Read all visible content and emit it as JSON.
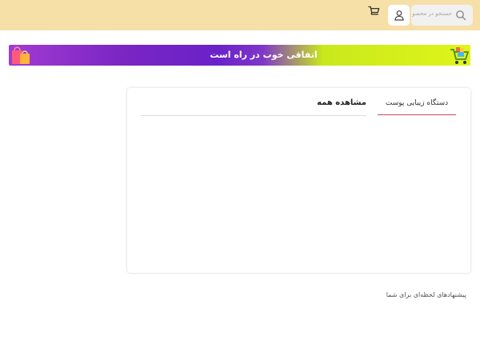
{
  "header": {
    "search_placeholder": "جستجو در محصو",
    "search_icon": "search-icon",
    "user_icon": "user-icon",
    "cart_icon": "cart-icon",
    "background_color": "#f7dfa8"
  },
  "banner": {
    "text": "اتفاقی خوب در راه است",
    "left_icon": "shopping-bag-icon",
    "right_icon": "shopping-cart-icon"
  },
  "product_section": {
    "active_tab": "دستگاه زیبایی پوست",
    "view_all": "مشاهده همه",
    "accent_color": "#c94a5a"
  },
  "suggestions": {
    "title": "پیشنهادهای لحظه‌ای برای شما"
  }
}
